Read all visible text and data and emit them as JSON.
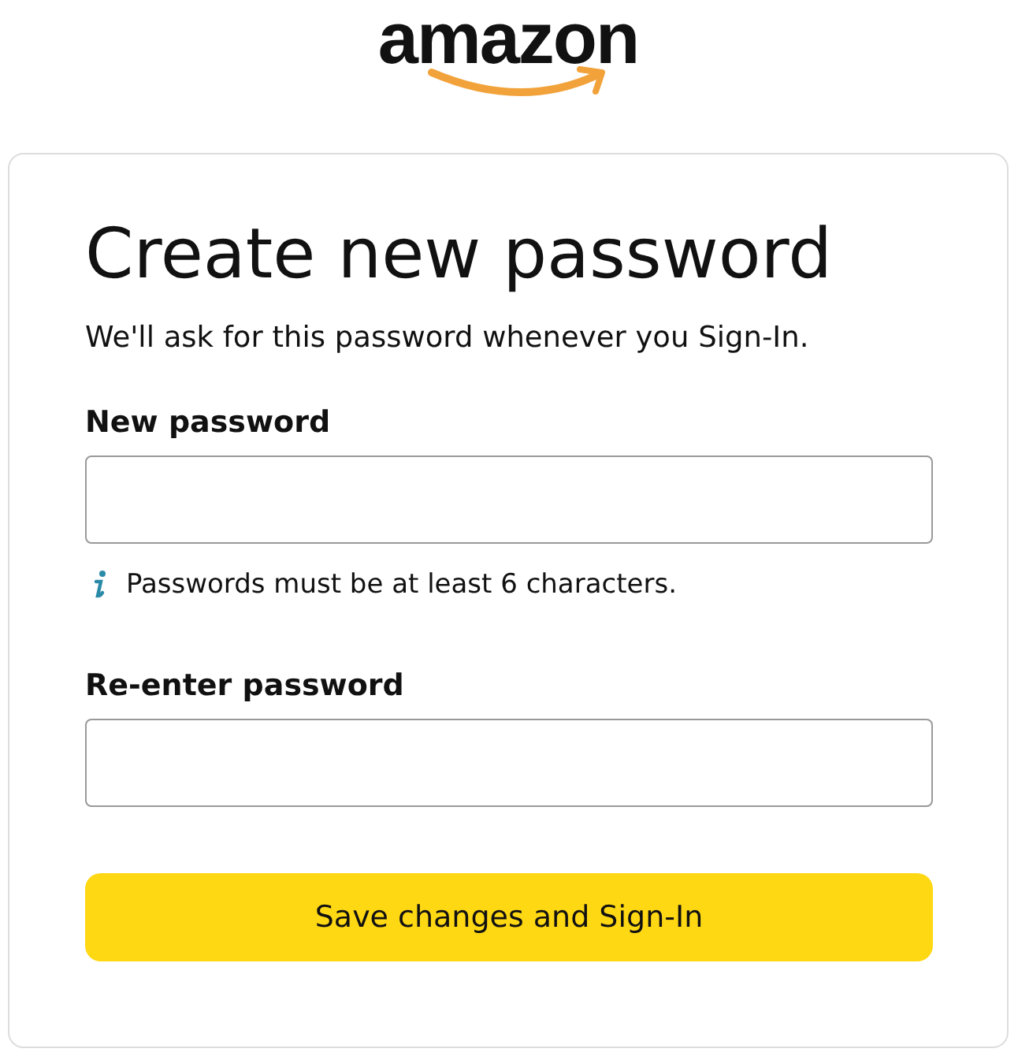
{
  "logo": {
    "text": "amazon"
  },
  "title": "Create new password",
  "subtitle": "We'll ask for this password whenever you Sign-In.",
  "fields": [
    {
      "label": "New password",
      "hint": "Passwords must be at least 6 characters."
    },
    {
      "label": "Re-enter password"
    }
  ],
  "button": "Save changes and Sign-In"
}
